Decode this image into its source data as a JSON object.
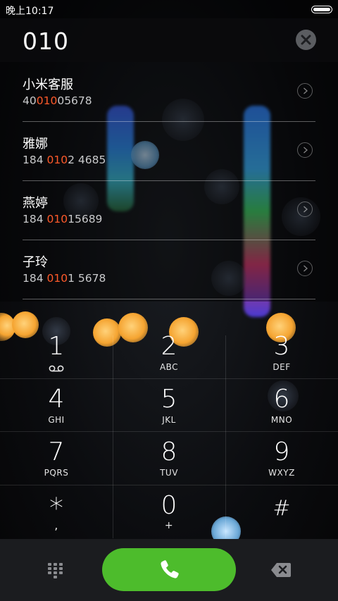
{
  "status": {
    "time": "晚上10:17"
  },
  "dialer": {
    "number": "010"
  },
  "contacts": [
    {
      "name": "小米客服",
      "phone_pre": "40",
      "phone_hl": "010",
      "phone_post": "05678"
    },
    {
      "name": "雅娜",
      "phone_pre": "184 ",
      "phone_hl": "010",
      "phone_post": "2 4685"
    },
    {
      "name": "燕婷",
      "phone_pre": "184 ",
      "phone_hl": "010",
      "phone_post": "15689"
    },
    {
      "name": "子玲",
      "phone_pre": "184 ",
      "phone_hl": "010",
      "phone_post": "1 5678"
    }
  ],
  "keys": [
    {
      "digit": "1",
      "sub": ""
    },
    {
      "digit": "2",
      "sub": "ABC"
    },
    {
      "digit": "3",
      "sub": "DEF"
    },
    {
      "digit": "4",
      "sub": "GHI"
    },
    {
      "digit": "5",
      "sub": "JKL"
    },
    {
      "digit": "6",
      "sub": "MNO"
    },
    {
      "digit": "7",
      "sub": "PQRS"
    },
    {
      "digit": "8",
      "sub": "TUV"
    },
    {
      "digit": "9",
      "sub": "WXYZ"
    },
    {
      "digit": "*",
      "sub": ","
    },
    {
      "digit": "0",
      "sub": "+"
    },
    {
      "digit": "#",
      "sub": ""
    }
  ],
  "icons": {
    "clear": "close-icon",
    "contact_arrow": "chevron-right-icon",
    "voicemail": "voicemail-icon",
    "call": "phone-icon",
    "dialpad": "dialpad-grid-icon",
    "delete": "backspace-icon"
  },
  "colors": {
    "highlight": "#ff5a2a",
    "call_button": "#4dbc2c",
    "bottom_bar": "#1b1c1f"
  }
}
